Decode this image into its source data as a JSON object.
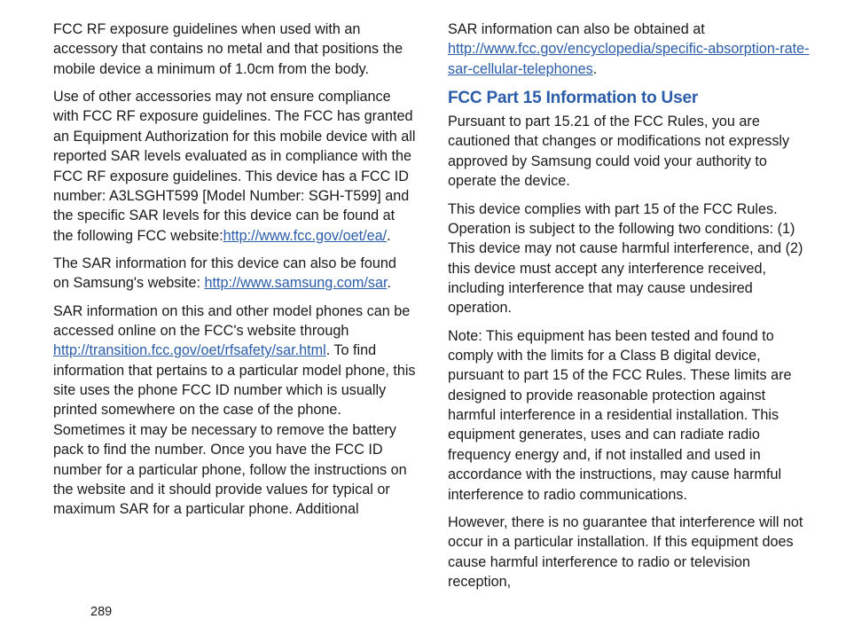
{
  "left": {
    "p1": "FCC RF exposure guidelines when used with an accessory that contains no metal and that positions the mobile device a minimum of 1.0cm from the body.",
    "p2a": "Use of other accessories may not ensure compliance with FCC RF exposure guidelines. The FCC has granted an Equipment Authorization for this mobile device with all reported SAR levels evaluated as in compliance with the FCC RF exposure guidelines. This device has a FCC ID number: A3LSGHT599 [Model Number: SGH-T599] and the specific SAR levels for this device can be found at the following FCC website:",
    "p2link": "http://www.fcc.gov/oet/ea/",
    "p2b": ".",
    "p3a": "The SAR information for this device can also be found on Samsung's website: ",
    "p3link": "http://www.samsung.com/sar",
    "p3b": ".",
    "p4a": "SAR information on this and other model phones can be accessed online on the FCC's website through ",
    "p4link": "http://transition.fcc.gov/oet/rfsafety/sar.html",
    "p4b": ". To find information that pertains to a particular model phone, this site uses the phone FCC ID number which is usually printed somewhere on the case of the phone. Sometimes it may be necessary to remove the battery pack to find the number. Once you have the FCC ID number for a particular phone, follow the instructions on the website and it should provide values for typical or maximum SAR for a particular phone. Additional"
  },
  "right": {
    "p1a": "SAR information can also be obtained at ",
    "p1link": "http://www.fcc.gov/encyclopedia/specific-absorption-rate-sar-cellular-telephones",
    "p1b": ".",
    "heading": "FCC Part 15 Information to User",
    "p2": "Pursuant to part 15.21 of the FCC Rules, you are cautioned that changes or modifications not expressly approved by Samsung could void your authority to operate the device.",
    "p3": "This device complies with part 15 of the FCC Rules. Operation is subject to the following two conditions: (1) This device may not cause harmful interference, and (2) this device must accept any interference received, including interference that may cause undesired operation.",
    "p4": "Note: This equipment has been tested and found to comply with the limits for a Class B digital device, pursuant to part 15 of the FCC Rules. These limits are designed to provide reasonable protection against harmful interference in a residential installation. This equipment generates, uses and can radiate radio frequency energy and, if not installed and used in accordance with the instructions, may cause harmful interference to radio communications.",
    "p5": "However, there is no guarantee that interference will not occur in a particular installation. If this equipment does cause harmful interference to radio or television reception,"
  },
  "pageNumber": "289"
}
